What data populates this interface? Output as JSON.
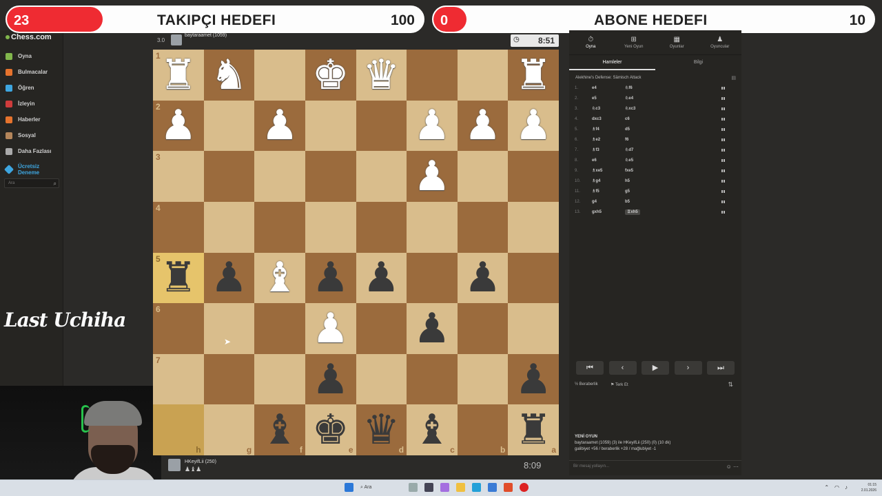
{
  "overlay": {
    "goal1": {
      "current": "23",
      "title": "TAKIPÇI HEDEFI",
      "target": "100",
      "fill_fraction": 0.23
    },
    "goal2": {
      "current": "0",
      "title": "ABONE HEDEFI",
      "target": "10",
      "fill_fraction": 0.0
    },
    "signature": "Last Uchiha"
  },
  "sidebar": {
    "logo": "Chess.com",
    "items": [
      {
        "label": "Oyna",
        "color": "#81b64c"
      },
      {
        "label": "Bulmacalar",
        "color": "#e6732d"
      },
      {
        "label": "Öğren",
        "color": "#3ea6e0"
      },
      {
        "label": "İzleyin",
        "color": "#cf3c3c"
      },
      {
        "label": "Haberler",
        "color": "#e6732d"
      },
      {
        "label": "Sosyal",
        "color": "#b4855a"
      },
      {
        "label": "Daha Fazlası",
        "color": "#aaaaaa"
      }
    ],
    "trial_line1": "Ücretsiz",
    "trial_line2": "Deneme",
    "search_placeholder": "Ara"
  },
  "top_player": {
    "rating_badge": "3.0",
    "name": "baytaraamet (1059)",
    "clock": "8:51"
  },
  "bottom_player": {
    "name": "HKeyifLii (250)",
    "captured": "♟♝♟",
    "clock": "8:09"
  },
  "board": {
    "ranks": [
      "1",
      "2",
      "3",
      "4",
      "5",
      "6",
      "7",
      ""
    ],
    "files": [
      "h",
      "g",
      "f",
      "e",
      "d",
      "c",
      "b",
      "a"
    ],
    "rows": [
      [
        "wR",
        "wN",
        "",
        "wK",
        "wQ",
        "",
        "",
        "wR"
      ],
      [
        "wP",
        "",
        "wP",
        "",
        "",
        "wP",
        "wP",
        "wP"
      ],
      [
        "",
        "",
        "",
        "",
        "",
        "wP",
        "",
        ""
      ],
      [
        "",
        "",
        "",
        "",
        "",
        "",
        "",
        ""
      ],
      [
        "bR",
        "bP",
        "wB",
        "bP",
        "bP",
        "",
        "bP",
        ""
      ],
      [
        "",
        "",
        "",
        "wP",
        "",
        "bP",
        "",
        ""
      ],
      [
        "",
        "",
        "",
        "bP",
        "",
        "",
        "",
        "bP"
      ],
      [
        "",
        "",
        "bB",
        "bK",
        "bQ",
        "bB",
        "",
        "bR"
      ]
    ]
  },
  "panel": {
    "tabs": [
      "Oyna",
      "Yeni Oyun",
      "Oyunlar",
      "Oyuncular"
    ],
    "subtabs": [
      "Hamleler",
      "Bilgi"
    ],
    "opening": "Alekhine's Defense: Sämisch Attack",
    "moves": [
      {
        "n": "1.",
        "w": "e4",
        "b": "♘f6"
      },
      {
        "n": "2.",
        "w": "e5",
        "b": "♘e4"
      },
      {
        "n": "3.",
        "w": "♘c3",
        "b": "♘xc3"
      },
      {
        "n": "4.",
        "w": "dxc3",
        "b": "c6"
      },
      {
        "n": "5.",
        "w": "♗f4",
        "b": "d5"
      },
      {
        "n": "6.",
        "w": "♗e2",
        "b": "f6"
      },
      {
        "n": "7.",
        "w": "♗f3",
        "b": "♘d7"
      },
      {
        "n": "8.",
        "w": "e6",
        "b": "♘e5"
      },
      {
        "n": "9.",
        "w": "♗xe5",
        "b": "fxe5"
      },
      {
        "n": "10.",
        "w": "♗g4",
        "b": "h5"
      },
      {
        "n": "11.",
        "w": "♗f5",
        "b": "g5"
      },
      {
        "n": "12.",
        "w": "g4",
        "b": "b5"
      },
      {
        "n": "13.",
        "w": "gxh5",
        "b": "♖xh5"
      }
    ],
    "draw_label": "Beraberlik",
    "resign_label": "Terk Et",
    "game_header": "YENİ OYUN",
    "game_line1": "baytaraamet (1059) (3) ile HKeyifLii (250) (0) (10 dk)",
    "game_line2": "galibiyet +56 / beraberlik +28 / mağlubiyet -1",
    "chat_placeholder": "Bir mesaj yollayın..."
  },
  "taskbar": {
    "search": "Ara",
    "time": "01:15",
    "date": "2.01.2026"
  }
}
